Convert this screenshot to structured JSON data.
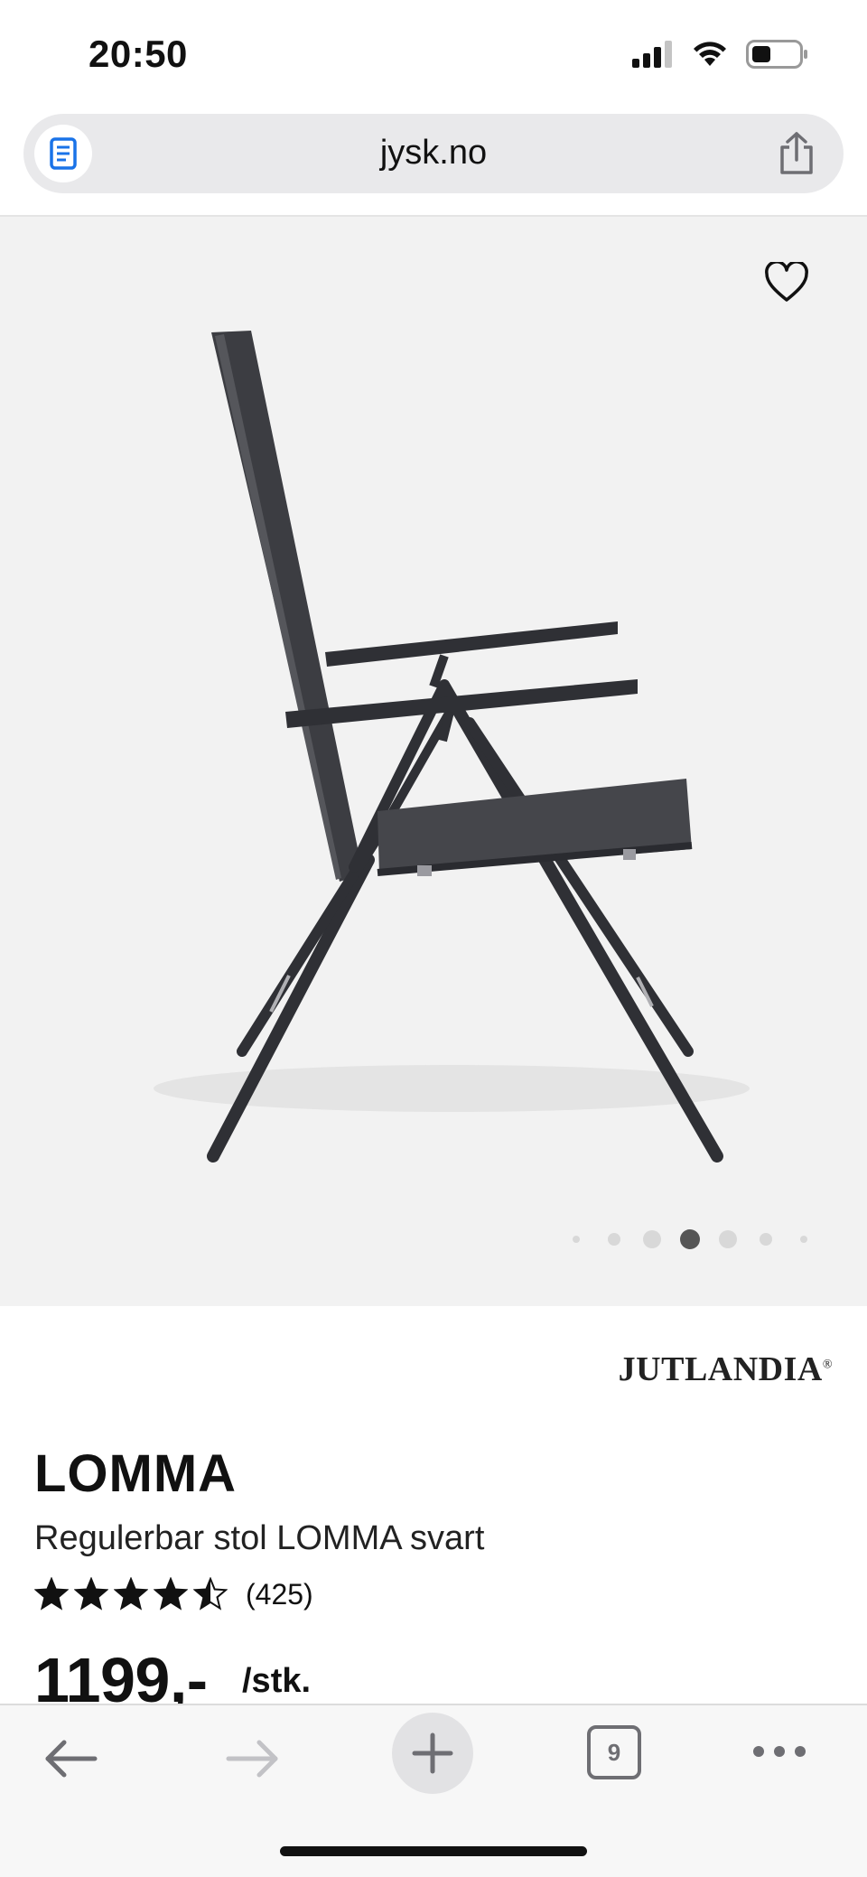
{
  "status_bar": {
    "time": "20:50",
    "icons": [
      "cellular-signal-icon",
      "wifi-icon",
      "battery-icon"
    ]
  },
  "browser": {
    "url": "jysk.no",
    "reader_icon": "reader-icon",
    "share_icon": "share-icon"
  },
  "product": {
    "brand": "JUTLANDIA",
    "brand_mark": "®",
    "title": "LOMMA",
    "subtitle": "Regulerbar stol LOMMA svart",
    "rating": 4.5,
    "rating_max": 5,
    "review_count": "(425)",
    "price": "1199,-",
    "price_unit": "/stk.",
    "image_carousel": {
      "total": 7,
      "active_index": 3
    }
  },
  "toolbar": {
    "tab_count": "9"
  },
  "colors": {
    "text": "#111111",
    "image_bg": "#f2f2f2",
    "toolbar_bg": "#f7f7f7",
    "reader_blue": "#1a73e8"
  }
}
